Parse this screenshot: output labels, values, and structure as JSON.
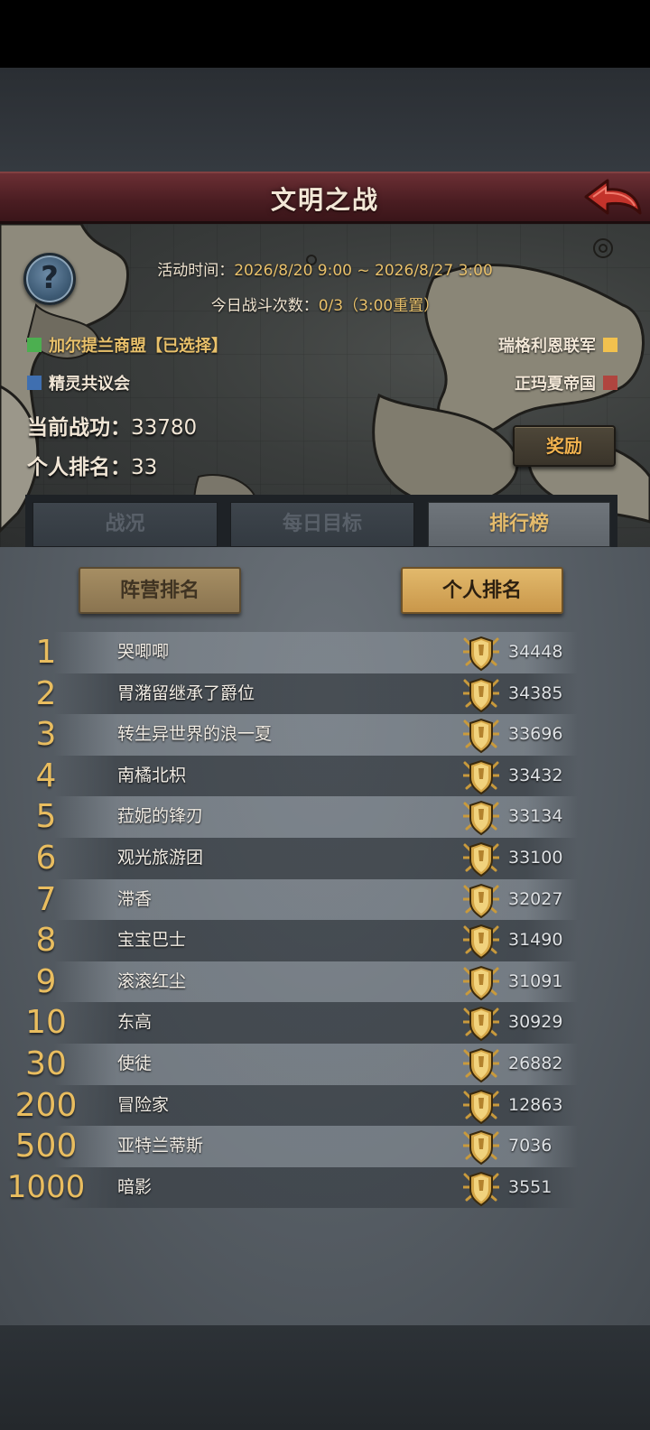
{
  "title": "文明之战",
  "back_icon": "back-arrow-icon",
  "help_glyph": "?",
  "event_time": {
    "label": "活动时间：",
    "value": "2026/8/20 9:00 ~ 2026/8/27 3:00"
  },
  "battle_count": {
    "label": "今日战斗次数：",
    "value": "0/3（3:00",
    "suffix": "重置）"
  },
  "factions": [
    {
      "name": "加尔提兰商盟【已选择】",
      "color": "#4caf50",
      "text_color": "#e9c16b"
    },
    {
      "name": "瑞格利恩联军",
      "color": "#f2c14e",
      "text_color": "#f1e6d6"
    },
    {
      "name": "精灵共议会",
      "color": "#3f6fb0",
      "text_color": "#f1e6d6"
    },
    {
      "name": "正玛夏帝国",
      "color": "#b0453f",
      "text_color": "#f1e6d6"
    }
  ],
  "stats": {
    "merit_label": "当前战功：",
    "merit_value": "33780",
    "rank_label": "个人排名：",
    "rank_value": "33"
  },
  "reward_button": "奖励",
  "tabs": [
    {
      "label": "战况",
      "active": false
    },
    {
      "label": "每日目标",
      "active": false
    },
    {
      "label": "排行榜",
      "active": true
    }
  ],
  "rank_tabs": {
    "faction": "阵营排名",
    "personal": "个人排名"
  },
  "leaderboard": [
    {
      "rank": "1",
      "name": "哭唧唧",
      "score": "34448"
    },
    {
      "rank": "2",
      "name": "胃潴留继承了爵位",
      "score": "34385"
    },
    {
      "rank": "3",
      "name": "转生异世界的浪一夏",
      "score": "33696"
    },
    {
      "rank": "4",
      "name": "南橘北枳",
      "score": "33432"
    },
    {
      "rank": "5",
      "name": "菈妮的锋刃",
      "score": "33134"
    },
    {
      "rank": "6",
      "name": "观光旅游团",
      "score": "33100"
    },
    {
      "rank": "7",
      "name": "滞香",
      "score": "32027"
    },
    {
      "rank": "8",
      "name": "宝宝巴士",
      "score": "31490"
    },
    {
      "rank": "9",
      "name": "滚滚红尘",
      "score": "31091"
    },
    {
      "rank": "10",
      "name": "东高",
      "score": "30929"
    },
    {
      "rank": "30",
      "name": "使徒",
      "score": "26882"
    },
    {
      "rank": "200",
      "name": "冒险家",
      "score": "12863"
    },
    {
      "rank": "500",
      "name": "亚特兰蒂斯",
      "score": "7036"
    },
    {
      "rank": "1000",
      "name": "暗影",
      "score": "3551"
    }
  ],
  "medal_icon": "gold-shield-medal-icon"
}
